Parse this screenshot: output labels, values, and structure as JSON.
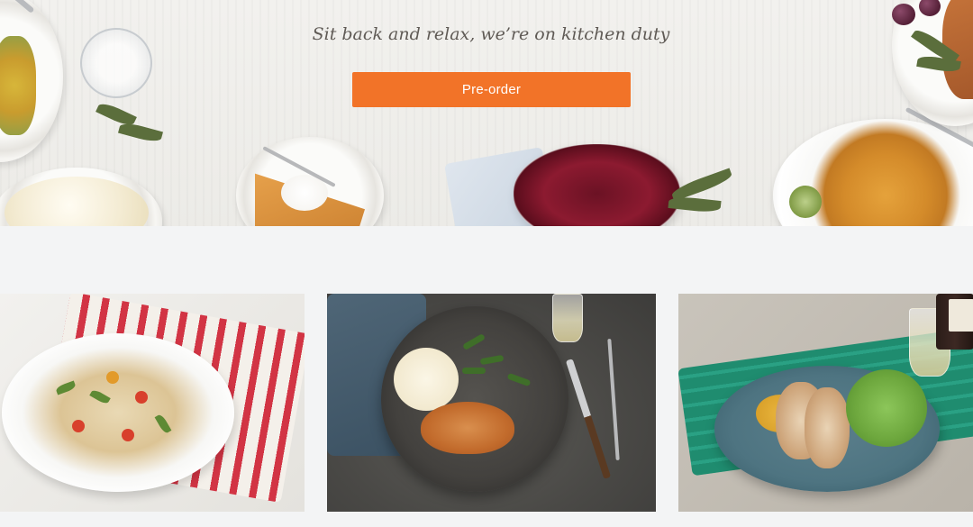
{
  "hero": {
    "tagline": "Sit back and relax, we’re on kitchen duty",
    "preorder_label": "Pre-order"
  },
  "colors": {
    "accent": "#f27328",
    "page_background": "#f3f4f5",
    "tagline_text": "#5f5a55"
  },
  "cards": [
    {
      "image": "pasta-dish-image"
    },
    {
      "image": "roast-chicken-skillet-image"
    },
    {
      "image": "fish-with-greens-image"
    }
  ]
}
